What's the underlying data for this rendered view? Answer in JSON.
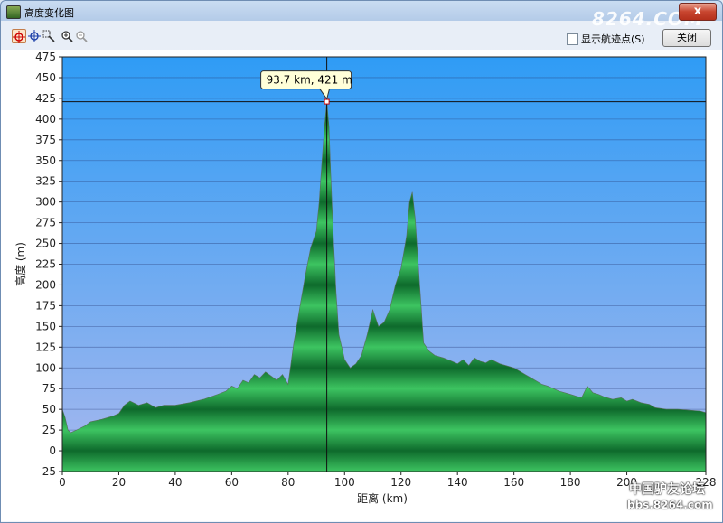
{
  "window": {
    "title": "高度变化图",
    "close_glyph": "x"
  },
  "watermark": {
    "top": "8264.COM",
    "bottom_line1": "中国驴友论坛",
    "bottom_line2": "bbs.8264.com"
  },
  "toolbar": {
    "tools": [
      "crosshair-select-icon",
      "crosshair-icon",
      "zoom-box-icon",
      "zoom-in-icon",
      "zoom-out-icon"
    ],
    "show_waypoints_label": "显示航迹点(S)",
    "show_waypoints_checked": false,
    "close_label": "关闭"
  },
  "chart_data": {
    "type": "area",
    "xlabel": "距离 (km)",
    "ylabel": "高度 (m)",
    "xlim": [
      0,
      228
    ],
    "ylim": [
      -25,
      475
    ],
    "x_ticks": [
      0,
      20,
      40,
      60,
      80,
      100,
      120,
      140,
      160,
      180,
      200,
      228
    ],
    "y_ticks": [
      -25,
      0,
      25,
      50,
      75,
      100,
      125,
      150,
      175,
      200,
      225,
      250,
      275,
      300,
      325,
      350,
      375,
      400,
      425,
      450,
      475
    ],
    "grid": true,
    "colors": {
      "sky_top": "#2f9cf5",
      "sky_bottom": "#a7b8ee",
      "terrain_light": "#3dc461",
      "terrain_dark": "#0e6a2c"
    },
    "x": [
      0,
      1,
      2,
      3,
      5,
      8,
      10,
      14,
      18,
      20,
      22,
      24,
      27,
      30,
      33,
      36,
      40,
      45,
      50,
      55,
      58,
      60,
      62,
      64,
      66,
      68,
      70,
      72,
      74,
      76,
      78,
      80,
      82,
      84,
      86,
      88,
      90,
      91,
      92,
      93,
      93.7,
      94.5,
      95,
      96,
      97,
      98,
      100,
      102,
      104,
      106,
      108,
      110,
      112,
      114,
      116,
      118,
      120,
      121,
      122,
      123,
      124,
      125,
      126,
      127,
      128,
      130,
      132,
      135,
      138,
      140,
      142,
      144,
      146,
      148,
      150,
      152,
      155,
      158,
      160,
      162,
      164,
      166,
      168,
      170,
      172,
      174,
      176,
      178,
      180,
      182,
      184,
      186,
      188,
      190,
      192,
      195,
      198,
      200,
      202,
      205,
      208,
      210,
      214,
      218,
      222,
      226,
      228
    ],
    "y": [
      50,
      40,
      25,
      22,
      25,
      30,
      35,
      38,
      42,
      45,
      55,
      60,
      55,
      58,
      52,
      55,
      55,
      58,
      62,
      68,
      72,
      78,
      75,
      85,
      82,
      92,
      88,
      95,
      90,
      85,
      92,
      80,
      130,
      170,
      210,
      245,
      265,
      300,
      350,
      395,
      421,
      390,
      340,
      260,
      190,
      140,
      110,
      100,
      105,
      115,
      140,
      170,
      150,
      155,
      170,
      200,
      220,
      240,
      260,
      300,
      312,
      280,
      230,
      180,
      130,
      120,
      115,
      112,
      108,
      105,
      110,
      103,
      112,
      108,
      106,
      110,
      105,
      102,
      100,
      96,
      92,
      88,
      84,
      80,
      78,
      75,
      72,
      70,
      68,
      66,
      64,
      78,
      70,
      68,
      65,
      62,
      64,
      60,
      62,
      58,
      56,
      52,
      50,
      50,
      49,
      48,
      46
    ],
    "cursor": {
      "x": 93.7,
      "y": 421,
      "label": "93.7 km, 421 m"
    }
  }
}
